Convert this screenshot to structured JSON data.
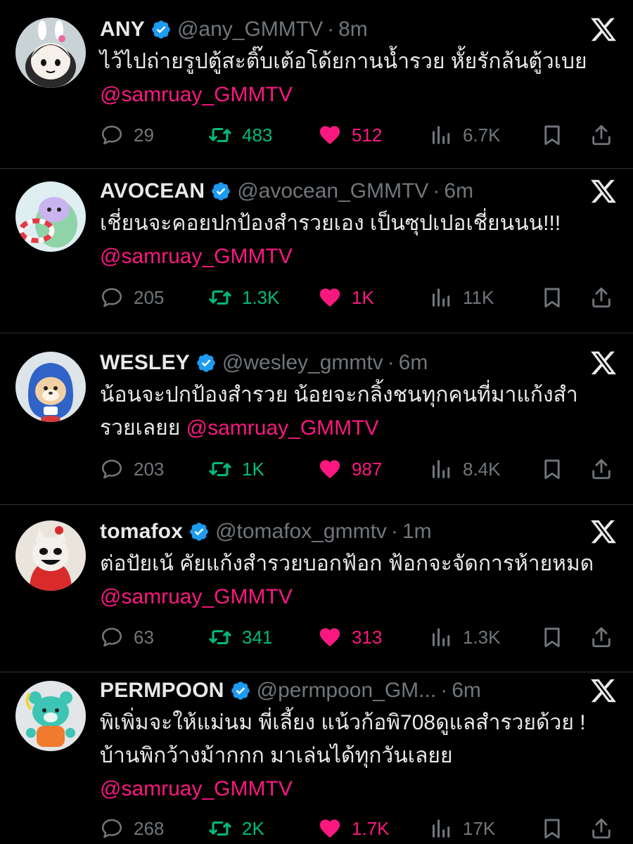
{
  "tweets": [
    {
      "name": "ANY",
      "handle": "@any_GMMTV",
      "time": "8m",
      "text": "ไว้ไปถ่ายรูปตู้สะติ๊บเต้อโด้ยกานน้ำรวย หั้ยรักล้นตู้วเบย ",
      "mention": "@samruay_GMMTV",
      "replies": "29",
      "reposts": "483",
      "likes": "512",
      "views": "6.7K"
    },
    {
      "name": "AVOCEAN",
      "handle": "@avocean_GMMTV",
      "time": "6m",
      "text": "เชี่ยนจะคอยปกป้องสำรวยเอง เป็นซุปเปอเชี่ยนนน!!! ",
      "mention": "@samruay_GMMTV",
      "replies": "205",
      "reposts": "1.3K",
      "likes": "1K",
      "views": "11K"
    },
    {
      "name": "WESLEY",
      "handle": "@wesley_gmmtv",
      "time": "6m",
      "text": "น้อนจะปกป้องสำรวย น้อยจะกลิ้งชนทุกคนที่มาแก้งสำรวยเลยย ",
      "mention": "@samruay_GMMTV",
      "replies": "203",
      "reposts": "1K",
      "likes": "987",
      "views": "8.4K"
    },
    {
      "name": "tomafox",
      "handle": "@tomafox_gmmtv",
      "time": "1m",
      "text": "ต่อปัยเน้ คัยแก้งสำรวยบอกฟ้อก ฟ้อกจะจัดการห้ายหมด ",
      "mention": "@samruay_GMMTV",
      "replies": "63",
      "reposts": "341",
      "likes": "313",
      "views": "1.3K"
    },
    {
      "name": "PERMPOON",
      "handle": "@permpoon_GM...",
      "time": "6m",
      "text": "พิเพิ่มจะให้แม่นม พี่เลี้ยง แน้วก้อพิ708ดูแลสำรวยด้วย ! บ้านพิกว้างม้ากกก มาเล่นได้ทุกวันเลยย ",
      "mention": "@samruay_GMMTV",
      "replies": "268",
      "reposts": "2K",
      "likes": "1.7K",
      "views": "17K"
    }
  ],
  "colors": {
    "background": "#000000",
    "text": "#e7e9ea",
    "muted": "#71767b",
    "mention": "#f91880",
    "repost": "#00ba7c",
    "like": "#f91880",
    "verified": "#1d9bf0"
  },
  "icons": {
    "verified": "verified-badge-icon",
    "platform": "x-logo-icon",
    "reply": "reply-icon",
    "repost": "repost-icon",
    "like": "heart-icon",
    "views": "views-icon",
    "bookmark": "bookmark-icon",
    "share": "share-icon"
  }
}
